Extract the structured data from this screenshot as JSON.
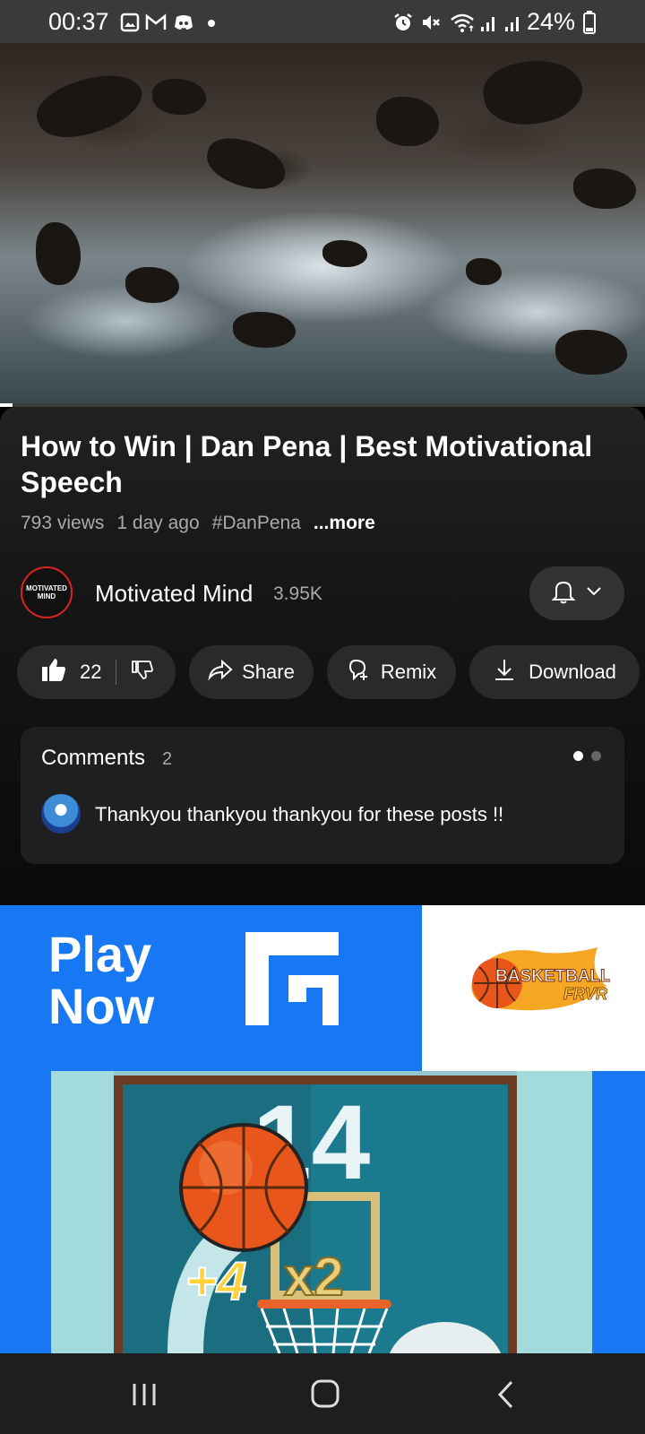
{
  "status_bar": {
    "time": "00:37",
    "battery": "24%",
    "left_icons": [
      "gallery-icon",
      "gmail-icon",
      "discord-icon",
      "dot-icon"
    ],
    "right_icons": [
      "alarm-icon",
      "mute-icon",
      "wifi-icon",
      "signal-icon",
      "signal-icon",
      "battery-icon"
    ]
  },
  "video": {
    "progress_fraction": 0.02
  },
  "info": {
    "title": "How to Win | Dan Pena | Best Motivational Speech",
    "views": "793 views",
    "age": "1 day ago",
    "hashtag": "#DanPena",
    "more_label": "...more"
  },
  "channel": {
    "avatar_text": "MOTIVATED MIND",
    "name": "Motivated Mind",
    "subscribers": "3.95K"
  },
  "actions": {
    "like_count": "22",
    "share_label": "Share",
    "remix_label": "Remix",
    "download_label": "Download"
  },
  "comments": {
    "title": "Comments",
    "count": "2",
    "top_comment": "Thankyou thankyou thankyou for these posts !!"
  },
  "ad": {
    "cta_line1": "Play",
    "cta_line2": "Now",
    "game_logo_line1": "BASKETBALL",
    "game_logo_line2": "FRVR",
    "score": "14",
    "points": "+4",
    "multiplier": "x2",
    "colors": {
      "facebook_blue": "#1877f2",
      "ball": "#e8561c"
    }
  },
  "nav": {
    "buttons": [
      "recents-icon",
      "home-icon",
      "back-icon"
    ]
  }
}
